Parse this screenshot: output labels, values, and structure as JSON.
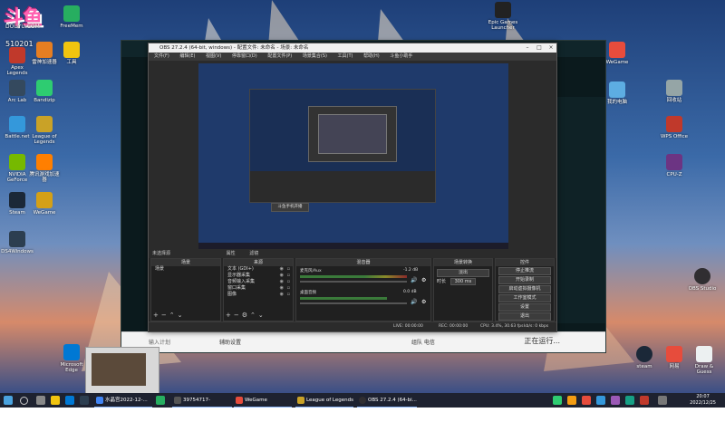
{
  "overlay": {
    "logo_text": "斗鱼",
    "logo_sub": "DOUYU.COM",
    "viewer_count": "510201"
  },
  "desktop_icons": [
    {
      "label": "Apex Legends",
      "color": "#c0392b"
    },
    {
      "label": "雷神加速器",
      "color": "#e67e22"
    },
    {
      "label": "Arc Lab",
      "color": "#34495e"
    },
    {
      "label": "Bandizip",
      "color": "#2ecc71"
    },
    {
      "label": "Battle.net",
      "color": "#3498db"
    },
    {
      "label": "League of Legends",
      "color": "#c9a227"
    },
    {
      "label": "NVIDIA GeForce",
      "color": "#76b900"
    },
    {
      "label": "腾讯游戏加速器",
      "color": "#ff7f00"
    },
    {
      "label": "Steam",
      "color": "#1b2838"
    },
    {
      "label": "WeGame",
      "color": "#d4a017"
    },
    {
      "label": "DS4Windows",
      "color": "#2c3e50"
    },
    {
      "label": "Microsoft Edge",
      "color": "#0078d4"
    },
    {
      "label": "工具",
      "color": "#f1c40f"
    },
    {
      "label": "FreeMem",
      "color": "#27ae60"
    },
    {
      "label": "Epic Games Launcher",
      "color": "#222222"
    },
    {
      "label": "我的电脑",
      "color": "#5dade2"
    },
    {
      "label": "WeGame",
      "color": "#e74c3c"
    },
    {
      "label": "回收站",
      "color": "#95a5a6"
    },
    {
      "label": "WPS Office",
      "color": "#c0392b"
    },
    {
      "label": "CPU-Z",
      "color": "#6c3483"
    },
    {
      "label": "OBS Studio",
      "color": "#302e31"
    },
    {
      "label": "steam",
      "color": "#1b2838"
    },
    {
      "label": "网易",
      "color": "#e74c3c"
    },
    {
      "label": "Draw & Guess",
      "color": "#ecf0f1"
    }
  ],
  "league": {
    "bottom_input_placeholder": "输入计划",
    "helper_label": "辅助设置",
    "chat_label": "组队 电信",
    "running_label": "正在运行..."
  },
  "obs": {
    "title": "OBS 27.2.4 (64-bit, windows) - 配置文件: 未命名 - 场景: 未命名",
    "menu": [
      "文件(F)",
      "编辑(E)",
      "视图(V)",
      "停靠窗口(D)",
      "配置文件(P)",
      "场景集合(S)",
      "工具(T)",
      "帮助(H)",
      "斗鱼小助手"
    ],
    "preview_stream_label": "斗鱼手机开播",
    "strip": {
      "no_source": "未选择源",
      "properties": "属性",
      "filters": "滤镜"
    },
    "docks": {
      "scenes": {
        "title": "场景",
        "items": [
          "场景"
        ]
      },
      "sources": {
        "title": "来源",
        "items": [
          "文本 (GDI+)",
          "显示器采集",
          "音频输入采集",
          "窗口采集",
          "图像"
        ]
      },
      "mixer": {
        "title": "混音器",
        "channels": [
          {
            "name": "麦克风/Aux",
            "db": "-1.2 dB"
          },
          {
            "name": "桌面音频",
            "db": "0.0 dB"
          }
        ]
      },
      "transitions": {
        "title": "场景转换",
        "type": "淡出",
        "duration_label": "时长",
        "duration": "300 ms"
      },
      "controls": {
        "title": "控件",
        "buttons": [
          "停止推流",
          "开始录制",
          "启动虚拟摄像机",
          "工作室模式",
          "设置",
          "退出"
        ]
      }
    },
    "status": {
      "live": "LIVE: 00:00:00",
      "rec": "REC: 00:00:00",
      "cpu": "CPU: 3.4%, 30.63 fps",
      "kbps": "kb/s: 0 kbps"
    }
  },
  "taskbar": {
    "apps": [
      {
        "label": "水晶宫2022-12-...",
        "color": "#4285f4"
      },
      {
        "label": "39754717-myhou...",
        "color": "#555555"
      },
      {
        "label": "WeGame",
        "color": "#e74c3c"
      },
      {
        "label": "League of Legends",
        "color": "#c9a227"
      },
      {
        "label": "OBS 27.2.4 (64-bi...",
        "color": "#302e31"
      }
    ],
    "time": "20:07",
    "date": "2022/12/25"
  }
}
